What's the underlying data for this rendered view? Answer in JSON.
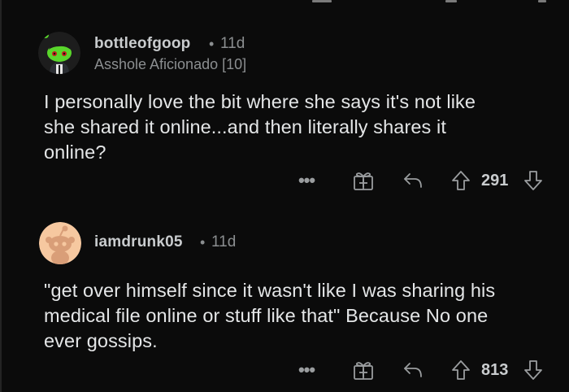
{
  "comments": [
    {
      "username": "bottleofgoop",
      "separator": "•",
      "age": "11d",
      "flair": "Asshole Aficionado [10]",
      "body_lines": [
        "I personally love the bit where she says it's not like",
        "she shared it online...and then literally shares it",
        "online?"
      ],
      "more_label": "•••",
      "score": "291",
      "avatar_icon": "green-snoo-avatar-icon"
    },
    {
      "username": "iamdrunk05",
      "separator": "•",
      "age": "11d",
      "flair": "",
      "body_lines": [
        "\"get over himself since it wasn't like I was sharing his",
        "medical file online or stuff like that\" Because No one",
        "ever gossips."
      ],
      "more_label": "•••",
      "score": "813",
      "avatar_icon": "default-snoo-avatar-icon"
    }
  ],
  "colors": {
    "background": "#0b0b0b",
    "text": "#e4e6e7",
    "meta": "#8b8e90",
    "icon": "#9a9d9f"
  }
}
